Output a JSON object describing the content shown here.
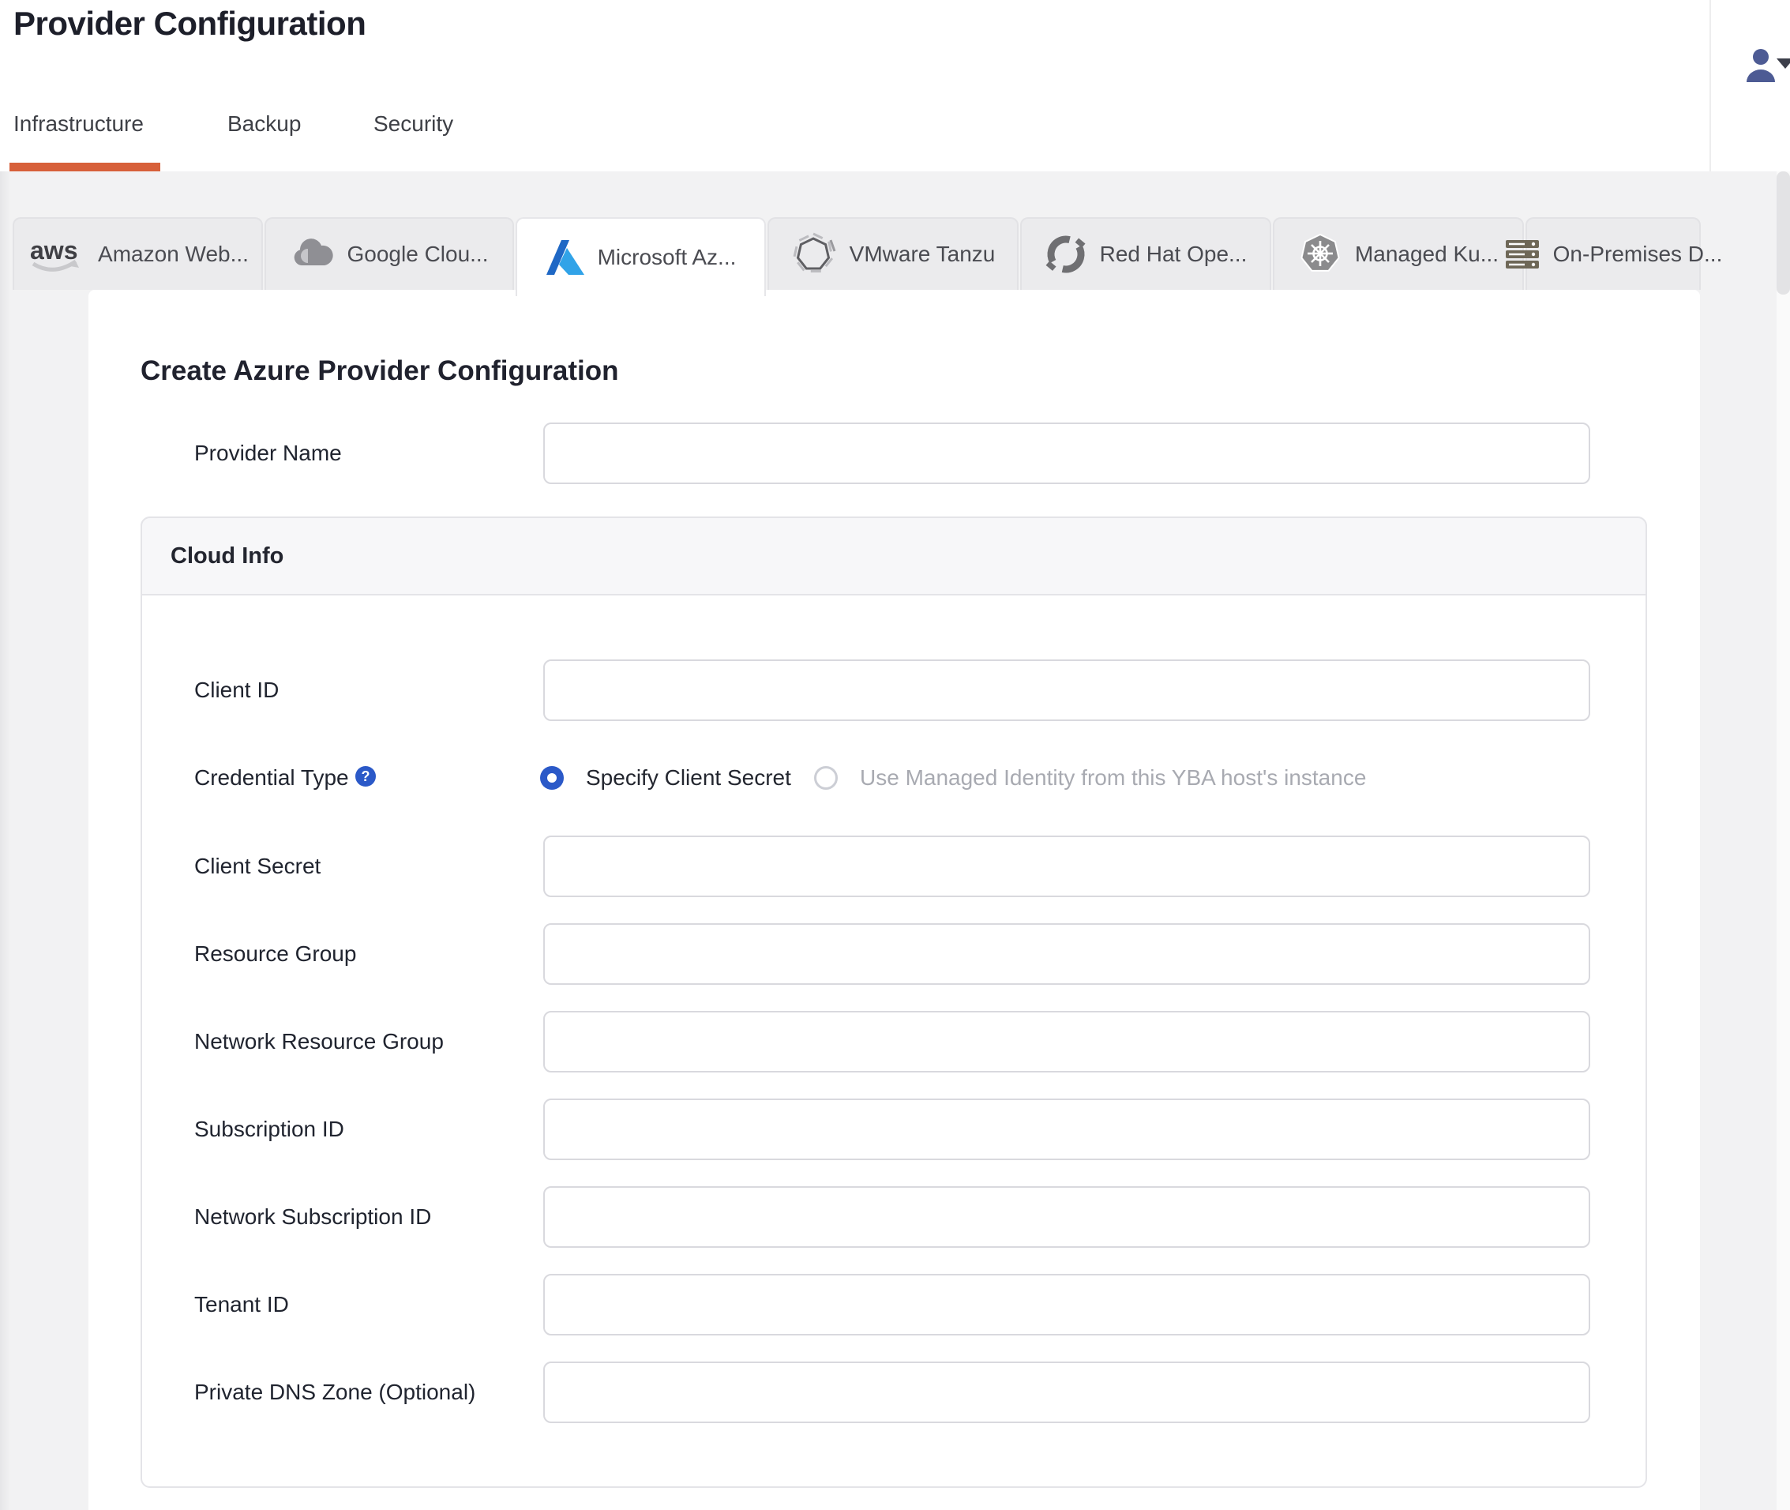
{
  "header": {
    "title": "Provider Configuration",
    "user_icon": "person-icon",
    "user_menu_caret": "chevron-down"
  },
  "nav_tabs": {
    "active_color": "#d7603a",
    "items": [
      {
        "label": "Infrastructure",
        "active": true
      },
      {
        "label": "Backup",
        "active": false
      },
      {
        "label": "Security",
        "active": false
      }
    ]
  },
  "provider_tabs": {
    "items": [
      {
        "label": "Amazon Web...",
        "icon": "aws-logo",
        "active": false
      },
      {
        "label": "Google Clou...",
        "icon": "google-cloud-logo",
        "active": false
      },
      {
        "label": "Microsoft Az...",
        "icon": "azure-logo",
        "active": true
      },
      {
        "label": "VMware Tanzu",
        "icon": "vmware-tanzu-logo",
        "active": false
      },
      {
        "label": "Red Hat Ope...",
        "icon": "openshift-logo",
        "active": false
      },
      {
        "label": "Managed Ku...",
        "icon": "kubernetes-logo",
        "active": false
      },
      {
        "label": "On-Premises D...",
        "icon": "server-rack-icon",
        "active": false
      }
    ]
  },
  "form": {
    "heading": "Create Azure Provider Configuration",
    "provider_name": {
      "label": "Provider Name",
      "value": "",
      "placeholder": ""
    },
    "section": {
      "title": "Cloud Info"
    },
    "credential": {
      "label": "Credential Type",
      "help_glyph": "?",
      "options": [
        {
          "label": "Specify Client Secret",
          "selected": true,
          "disabled": false
        },
        {
          "label": "Use Managed Identity from this YBA host's instance",
          "selected": false,
          "disabled": true
        }
      ]
    },
    "fields": [
      {
        "label": "Client ID",
        "value": "",
        "placeholder": ""
      },
      {
        "label": "Client Secret",
        "value": "",
        "placeholder": ""
      },
      {
        "label": "Resource Group",
        "value": "",
        "placeholder": ""
      },
      {
        "label": "Network Resource Group",
        "value": "",
        "placeholder": ""
      },
      {
        "label": "Subscription ID",
        "value": "",
        "placeholder": ""
      },
      {
        "label": "Network Subscription ID",
        "value": "",
        "placeholder": ""
      },
      {
        "label": "Tenant ID",
        "value": "",
        "placeholder": ""
      },
      {
        "label": "Private DNS Zone (Optional)",
        "value": "",
        "placeholder": ""
      }
    ]
  },
  "colors": {
    "accent_orange": "#d7603a",
    "accent_blue": "#2b59c8",
    "user_icon_blue": "#4d5b94",
    "page_bg": "#f2f2f3",
    "tab_bg": "#ebebed",
    "panel_border": "#e4e4e8",
    "input_border": "#d9d9de",
    "label_text": "#20242f",
    "disabled_text": "#a8aab1"
  }
}
